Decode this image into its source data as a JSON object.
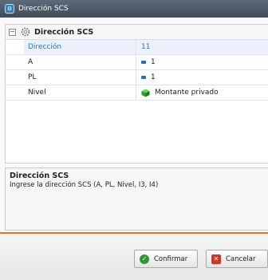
{
  "window": {
    "title": "Dirección SCS",
    "app_icon": "app-logo-icon"
  },
  "group": {
    "label": "Dirección SCS",
    "collapse_symbol": "⊟",
    "icon": "gear-icon"
  },
  "properties": [
    {
      "name": "Dirección",
      "value": "11",
      "icon": null
    },
    {
      "name": "A",
      "value": "1",
      "icon": "blue-square-icon"
    },
    {
      "name": "PL",
      "value": "1",
      "icon": "blue-square-icon"
    },
    {
      "name": "Nivel",
      "value": "Montante privado",
      "icon": "green-cube-icon"
    }
  ],
  "description": {
    "title": "Dirección SCS",
    "text": "Ingrese la dirección SCS (A, PL, Nivel, I3, I4)"
  },
  "buttons": {
    "confirm_label": "Confirmar",
    "cancel_label": "Cancelar"
  },
  "colors": {
    "accent": "#e2751f",
    "selected_text": "#3b6ea5",
    "ok": "#2f9a2f",
    "cancel": "#d2332b"
  }
}
